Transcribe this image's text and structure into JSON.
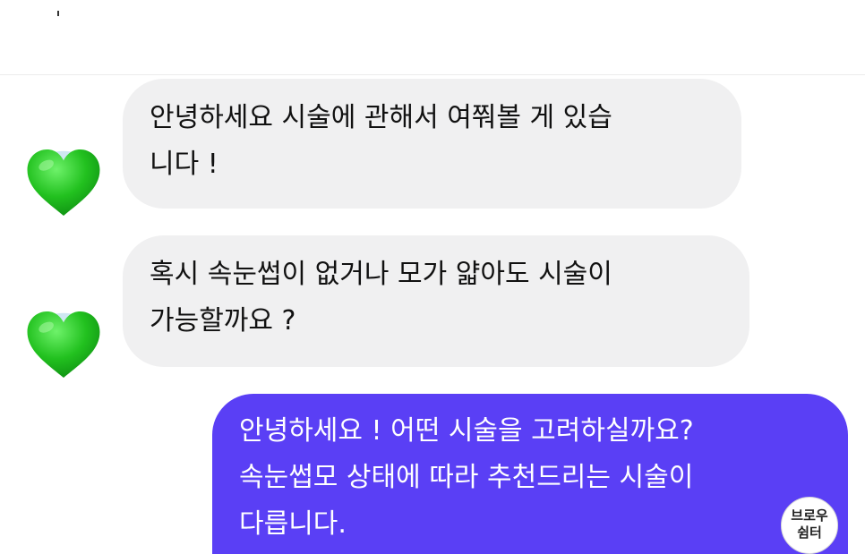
{
  "messages": [
    {
      "sender": "other",
      "avatar_icon": "green-heart-icon",
      "lines": [
        "안녕하세요 시술에 관해서 여쭤볼 게 있습",
        "니다 !"
      ]
    },
    {
      "sender": "other",
      "avatar_icon": "green-heart-icon",
      "lines": [
        "혹시 속눈썹이 없거나 모가 얇아도 시술이",
        "가능할까요 ?"
      ]
    },
    {
      "sender": "me",
      "lines": [
        "안녕하세요 ! 어떤 시술을 고려하실까요?",
        "속눈썹모 상태에 따라 추천드리는 시술이",
        "다릅니다."
      ]
    }
  ],
  "watermark": {
    "line1": "브로우",
    "line2": "쉼터"
  },
  "colors": {
    "incoming_bubble": "#f0f0f1",
    "outgoing_bubble": "#5a3ff5",
    "avatar_heart": "#22c11f"
  }
}
